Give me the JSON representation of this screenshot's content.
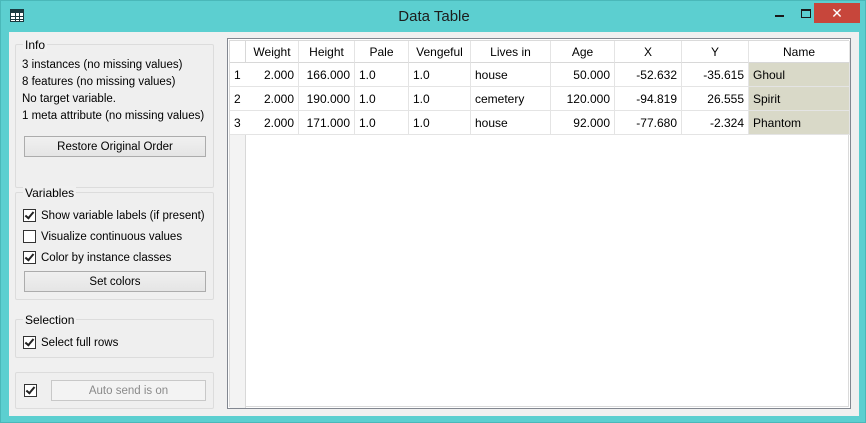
{
  "window": {
    "title": "Data Table",
    "minimize": "—",
    "maximize": "□",
    "close": "✕"
  },
  "info": {
    "title": "Info",
    "lines": [
      "3 instances (no missing values)",
      "8 features (no missing values)",
      "No target variable.",
      "1 meta attribute (no missing values)"
    ],
    "restore_button": "Restore Original Order"
  },
  "variables": {
    "title": "Variables",
    "options": [
      {
        "label": "Show variable labels (if present)",
        "checked": true
      },
      {
        "label": "Visualize continuous values",
        "checked": false
      },
      {
        "label": "Color by instance classes",
        "checked": true
      }
    ],
    "set_colors_button": "Set colors"
  },
  "selection": {
    "title": "Selection",
    "select_full_rows": {
      "label": "Select full rows",
      "checked": true
    }
  },
  "autosend": {
    "checked": true,
    "button": "Auto send is on"
  },
  "table": {
    "columns": [
      "Weight",
      "Height",
      "Pale",
      "Vengeful",
      "Lives in",
      "Age",
      "X",
      "Y",
      "Name"
    ],
    "row_numbers": [
      "1",
      "2",
      "3"
    ],
    "rows": [
      [
        "2.000",
        "166.000",
        "1.0",
        "1.0",
        "house",
        "50.000",
        "-52.632",
        "-35.615",
        "Ghoul"
      ],
      [
        "2.000",
        "190.000",
        "1.0",
        "1.0",
        "cemetery",
        "120.000",
        "-94.819",
        "26.555",
        "Spirit"
      ],
      [
        "2.000",
        "171.000",
        "1.0",
        "1.0",
        "house",
        "92.000",
        "-77.680",
        "-2.324",
        "Phantom"
      ]
    ],
    "meta_color": "#d9d9c8"
  }
}
